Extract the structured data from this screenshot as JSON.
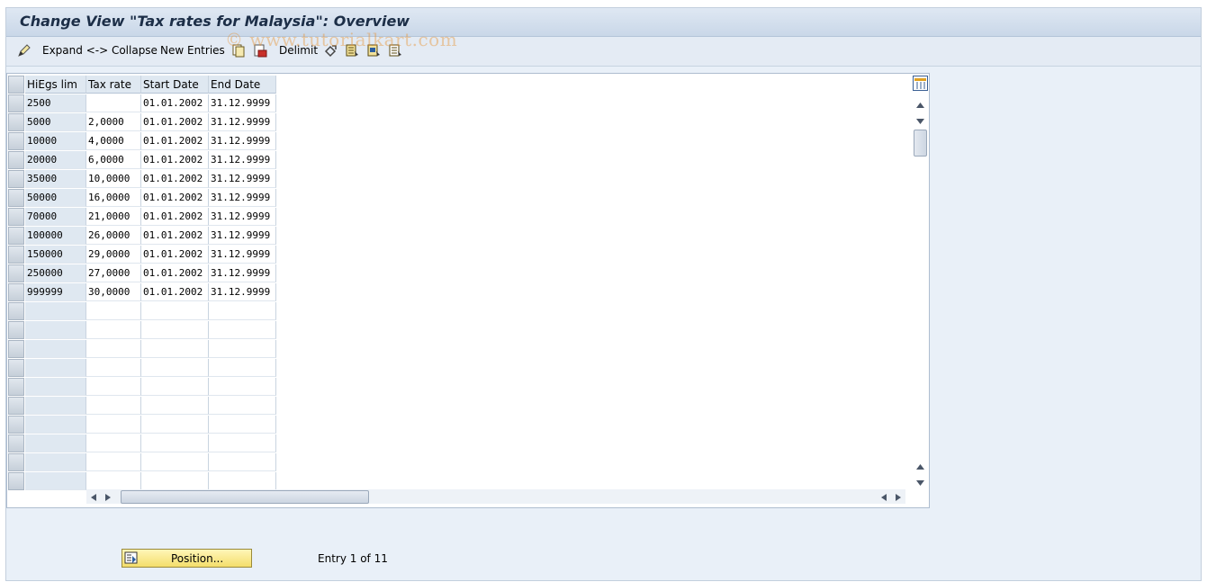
{
  "window": {
    "title": "Change View \"Tax rates for Malaysia\": Overview"
  },
  "toolbar": {
    "expand_collapse": "Expand <-> Collapse",
    "new_entries": "New Entries",
    "delimit": "Delimit",
    "icons": [
      "edit-icon",
      "copy-icon",
      "delete-icon",
      "undo-icon",
      "select-all-icon",
      "select-block-icon",
      "deselect-all-icon"
    ]
  },
  "watermark": "© www.tutorialkart.com",
  "table": {
    "columns": [
      "HiEgs lim",
      "Tax rate",
      "Start Date",
      "End Date"
    ],
    "rows": [
      [
        "2500",
        "",
        "01.01.2002",
        "31.12.9999"
      ],
      [
        "5000",
        "2,0000",
        "01.01.2002",
        "31.12.9999"
      ],
      [
        "10000",
        "4,0000",
        "01.01.2002",
        "31.12.9999"
      ],
      [
        "20000",
        "6,0000",
        "01.01.2002",
        "31.12.9999"
      ],
      [
        "35000",
        "10,0000",
        "01.01.2002",
        "31.12.9999"
      ],
      [
        "50000",
        "16,0000",
        "01.01.2002",
        "31.12.9999"
      ],
      [
        "70000",
        "21,0000",
        "01.01.2002",
        "31.12.9999"
      ],
      [
        "100000",
        "26,0000",
        "01.01.2002",
        "31.12.9999"
      ],
      [
        "150000",
        "29,0000",
        "01.01.2002",
        "31.12.9999"
      ],
      [
        "250000",
        "27,0000",
        "01.01.2002",
        "31.12.9999"
      ],
      [
        "999999",
        "30,0000",
        "01.01.2002",
        "31.12.9999"
      ]
    ],
    "empty_rows": 10
  },
  "footer": {
    "position_button": "Position...",
    "entry_info": "Entry 1 of 11"
  }
}
